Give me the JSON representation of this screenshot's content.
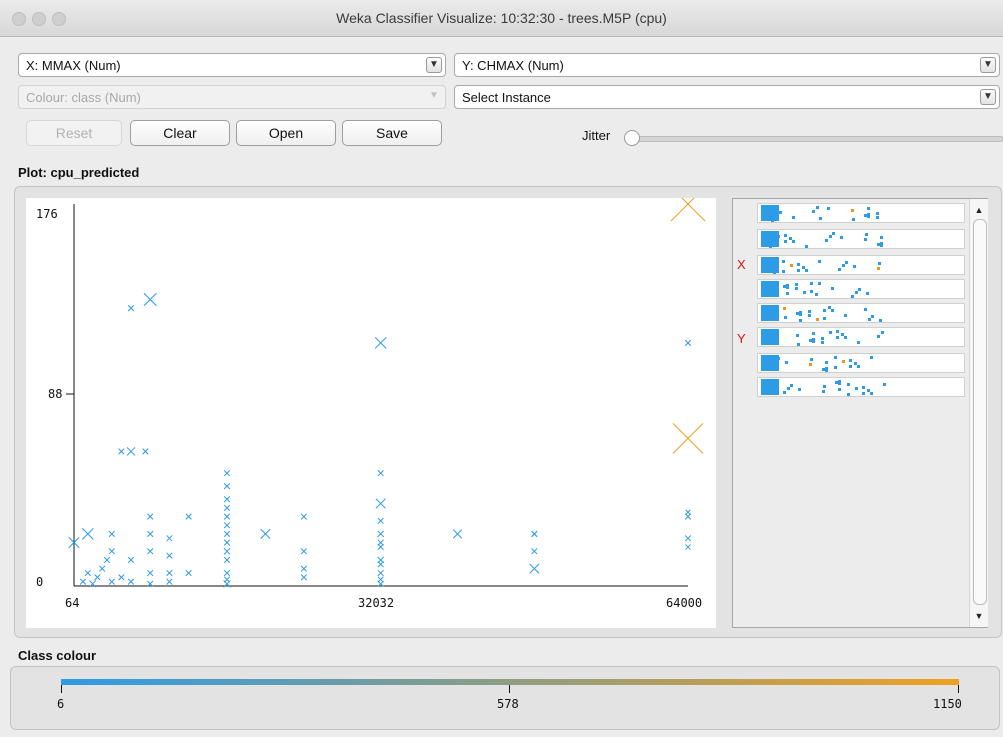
{
  "window": {
    "title": "Weka Classifier Visualize: 10:32:30 - trees.M5P (cpu)"
  },
  "controls": {
    "x_axis": "X: MMAX (Num)",
    "y_axis": "Y: CHMAX (Num)",
    "colour": "Colour: class (Num)",
    "select_instance": "Select Instance",
    "reset": "Reset",
    "clear": "Clear",
    "open": "Open",
    "save": "Save",
    "jitter": "Jitter",
    "jitter_value": 0
  },
  "plot_title": "Plot: cpu_predicted",
  "side_panel": {
    "x_marker": "X",
    "y_marker": "Y"
  },
  "class_colour": {
    "title": "Class colour",
    "min": "6",
    "mid": "578",
    "max": "1150",
    "gradient": [
      "#2d9be6",
      "#f0a020"
    ]
  },
  "chart_data": {
    "type": "scatter",
    "xlabel": "MMAX",
    "ylabel": "CHMAX",
    "x_ticks": [
      "64",
      "32032",
      "64000"
    ],
    "y_ticks": [
      "176",
      "88",
      "0"
    ],
    "xlim": [
      64,
      64000
    ],
    "ylim": [
      0,
      176
    ],
    "colors": {
      "low": "#2d9be6",
      "high": "#f0a020"
    },
    "points": [
      [
        64,
        20,
        0.28
      ],
      [
        1500,
        24,
        0.3
      ],
      [
        2000,
        1,
        0.15
      ],
      [
        1000,
        2,
        0.12
      ],
      [
        1500,
        6,
        0.12
      ],
      [
        2500,
        4,
        0.12
      ],
      [
        3000,
        8,
        0.12
      ],
      [
        4000,
        2,
        0.12
      ],
      [
        3500,
        12,
        0.12
      ],
      [
        4000,
        16,
        0.12
      ],
      [
        4000,
        24,
        0.12
      ],
      [
        5000,
        4,
        0.12
      ],
      [
        6000,
        2,
        0.12
      ],
      [
        6000,
        12,
        0.12
      ],
      [
        8000,
        1,
        0.12
      ],
      [
        8000,
        6,
        0.12
      ],
      [
        8000,
        16,
        0.12
      ],
      [
        8000,
        24,
        0.12
      ],
      [
        10000,
        2,
        0.12
      ],
      [
        10000,
        6,
        0.12
      ],
      [
        10000,
        14,
        0.12
      ],
      [
        10000,
        22,
        0.12
      ],
      [
        12000,
        6,
        0.12
      ],
      [
        12000,
        32,
        0.12
      ],
      [
        8000,
        32,
        0.12
      ],
      [
        6000,
        128,
        0.12
      ],
      [
        8000,
        132,
        0.35
      ],
      [
        5000,
        62,
        0.12
      ],
      [
        6000,
        62,
        0.2
      ],
      [
        7500,
        62,
        0.12
      ],
      [
        16000,
        1,
        0.16
      ],
      [
        16000,
        3,
        0.12
      ],
      [
        16000,
        6,
        0.12
      ],
      [
        16000,
        12,
        0.12
      ],
      [
        16000,
        16,
        0.14
      ],
      [
        16000,
        20,
        0.12
      ],
      [
        16000,
        24,
        0.12
      ],
      [
        16000,
        28,
        0.12
      ],
      [
        16000,
        32,
        0.12
      ],
      [
        16000,
        36,
        0.12
      ],
      [
        16000,
        40,
        0.12
      ],
      [
        16000,
        46,
        0.12
      ],
      [
        16000,
        52,
        0.12
      ],
      [
        20000,
        24,
        0.25
      ],
      [
        24000,
        4,
        0.12
      ],
      [
        24000,
        8,
        0.12
      ],
      [
        24000,
        16,
        0.12
      ],
      [
        24000,
        32,
        0.12
      ],
      [
        32000,
        1,
        0.12
      ],
      [
        32000,
        3,
        0.12
      ],
      [
        32000,
        6,
        0.12
      ],
      [
        32000,
        10,
        0.12
      ],
      [
        32000,
        12,
        0.14
      ],
      [
        32000,
        18,
        0.12
      ],
      [
        32000,
        24,
        0.14
      ],
      [
        32000,
        30,
        0.12
      ],
      [
        32000,
        38,
        0.25
      ],
      [
        32000,
        112,
        0.3
      ],
      [
        40000,
        24,
        0.22
      ],
      [
        48000,
        16,
        0.12
      ],
      [
        48000,
        24,
        0.12
      ],
      [
        48000,
        8,
        0.25
      ],
      [
        64000,
        32,
        0.12
      ],
      [
        64000,
        112,
        0.12
      ],
      [
        64000,
        34,
        0.08
      ],
      [
        64000,
        18,
        0.1
      ],
      [
        48000,
        24,
        0.12
      ],
      [
        32000,
        52,
        0.12
      ],
      [
        32000,
        20,
        0.12
      ],
      [
        64000,
        22,
        0.12
      ]
    ]
  }
}
